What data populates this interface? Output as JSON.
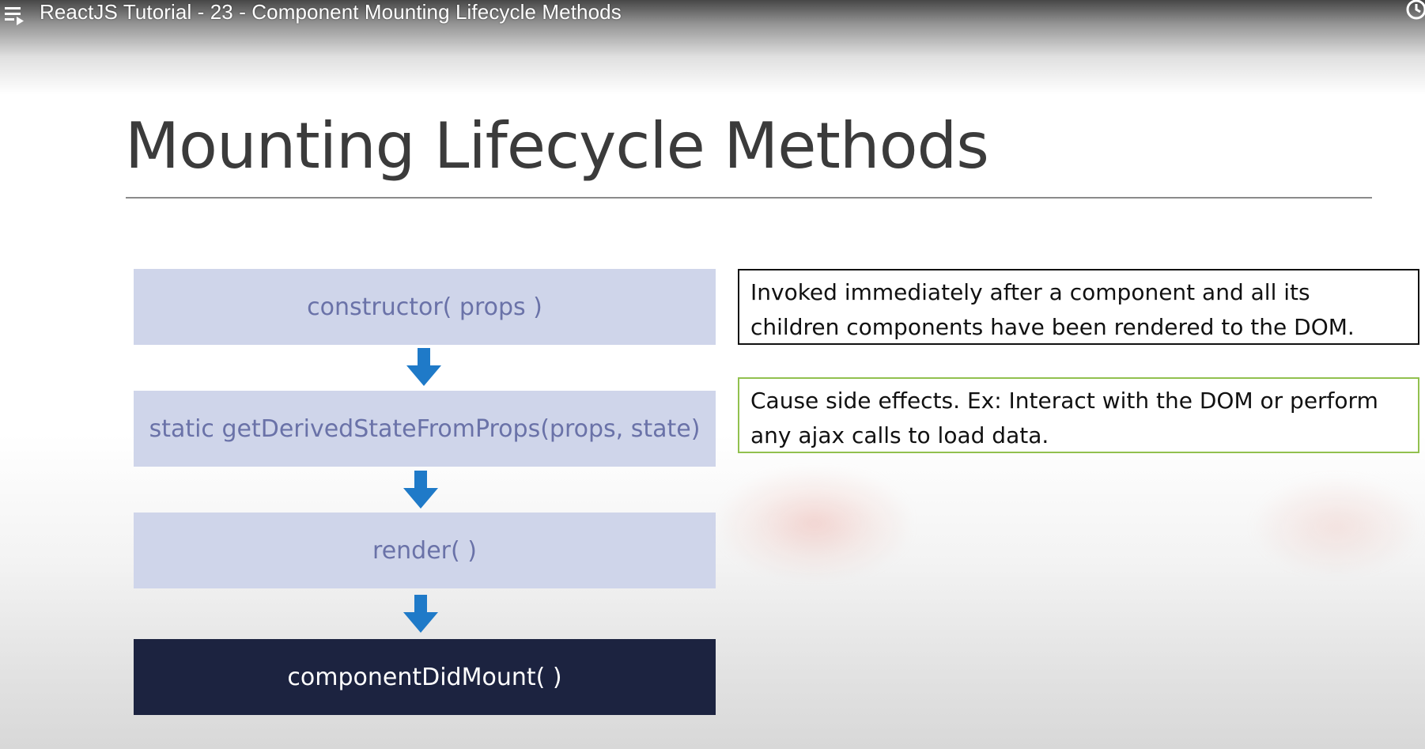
{
  "player": {
    "video_title": "ReactJS Tutorial - 23 - Component Mounting Lifecycle Methods",
    "icons": {
      "playlist": "playlist-icon",
      "watch_later": "clock-icon"
    }
  },
  "slide": {
    "title": "Mounting Lifecycle Methods",
    "flow": [
      {
        "label": "constructor( props )",
        "highlighted": false
      },
      {
        "label": "static getDerivedStateFromProps(props, state)",
        "highlighted": false
      },
      {
        "label": "render( )",
        "highlighted": false
      },
      {
        "label": "componentDidMount( )",
        "highlighted": true
      }
    ],
    "notes": [
      {
        "line1": "Invoked immediately after a component and all its",
        "line2": "children components have been rendered to the DOM.",
        "border_color": "#111111"
      },
      {
        "line1": "Cause side effects. Ex: Interact with the DOM or perform",
        "line2": "any ajax calls to load data.",
        "border_color": "#92c14f"
      }
    ],
    "colors": {
      "box_fill": "#cfd5ea",
      "box_text": "#6a72a8",
      "highlight_fill": "#1c2340",
      "highlight_text": "#ffffff",
      "arrow": "#1f7ac8"
    }
  }
}
